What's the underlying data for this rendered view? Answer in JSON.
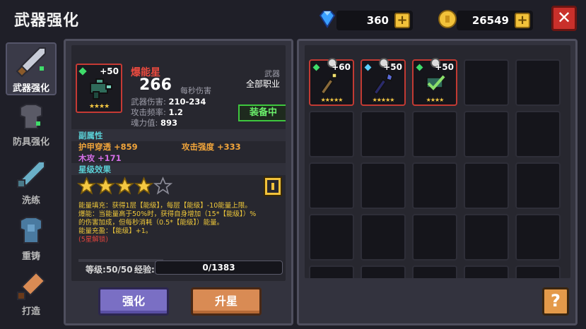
{
  "header": {
    "title": "武器强化"
  },
  "currency": {
    "gems": {
      "amount": "360",
      "icon": "diamond-icon"
    },
    "gold": {
      "amount": "26549",
      "icon": "gold-coin-icon"
    },
    "plus": "+"
  },
  "close": {
    "label": "✕"
  },
  "menu": {
    "items": [
      {
        "label": "武器强化",
        "icon": "sword-icon",
        "active": true
      },
      {
        "label": "防具强化",
        "icon": "armor-icon",
        "active": false
      },
      {
        "label": "洗练",
        "icon": "blade-icon",
        "active": false
      },
      {
        "label": "重铸",
        "icon": "chestplate-icon",
        "active": false
      },
      {
        "label": "打造",
        "icon": "hammer-icon",
        "active": false
      }
    ]
  },
  "weapon": {
    "level_badge": "+50",
    "name": "爆能星",
    "damage": "266",
    "damage_label": "每秒伤害",
    "type": "武器",
    "class": "全部职业",
    "stats": [
      {
        "label": "武器伤害:",
        "value": "210-234"
      },
      {
        "label": "攻击频率:",
        "value": "1.2"
      },
      {
        "label": "魂力值:",
        "value": "893"
      }
    ],
    "equipped_label": "装备中",
    "stars": 4,
    "max_stars": 5,
    "thumb_stars": "★★★★"
  },
  "sub_attributes": {
    "title": "副属性",
    "items": [
      {
        "label": "护甲穿透",
        "value": "+859",
        "color": "#f0a43a"
      },
      {
        "label": "攻击强度",
        "value": "+333",
        "color": "#f0a43a"
      },
      {
        "label": "木攻",
        "value": "+171",
        "color": "#d46ee6"
      }
    ]
  },
  "star_effect": {
    "title": "星级效果",
    "lines": [
      "能量填充：获得1层【能级】，每层【能级】-10能量上限。",
      "爆能：当能量高于50%时，获得自身增加（15*【能级】）%",
      "的伤害加成，但每秒消耗（0.5*【能级】）能量。",
      "能量充盈：【能级】+1。"
    ],
    "locked_line": "(5星解锁)"
  },
  "progress": {
    "level_label": "等级:",
    "level_value": "50/50",
    "exp_label": "经验:",
    "exp_value": "0/1383",
    "exp_fraction": 0
  },
  "buttons": {
    "enhance": "强化",
    "upgrade_star": "升星",
    "help": "?"
  },
  "inventory": {
    "rows": 5,
    "cols": 5,
    "items": [
      {
        "level": "+60",
        "gem_color": "#3fdc6a",
        "stars": "★★★★★",
        "icon": "staff-icon"
      },
      {
        "level": "+50",
        "gem_color": "#5ad0ff",
        "stars": "★★★★★",
        "icon": "scepter-icon"
      },
      {
        "level": "+50",
        "gem_color": "#3fdc6a",
        "stars": "★★★★",
        "icon": "selected-checkmark-icon"
      }
    ]
  },
  "colors": {
    "accent_red": "#c63a34",
    "equipped_green": "#3ec73e",
    "star_gold": "#f5c842"
  }
}
